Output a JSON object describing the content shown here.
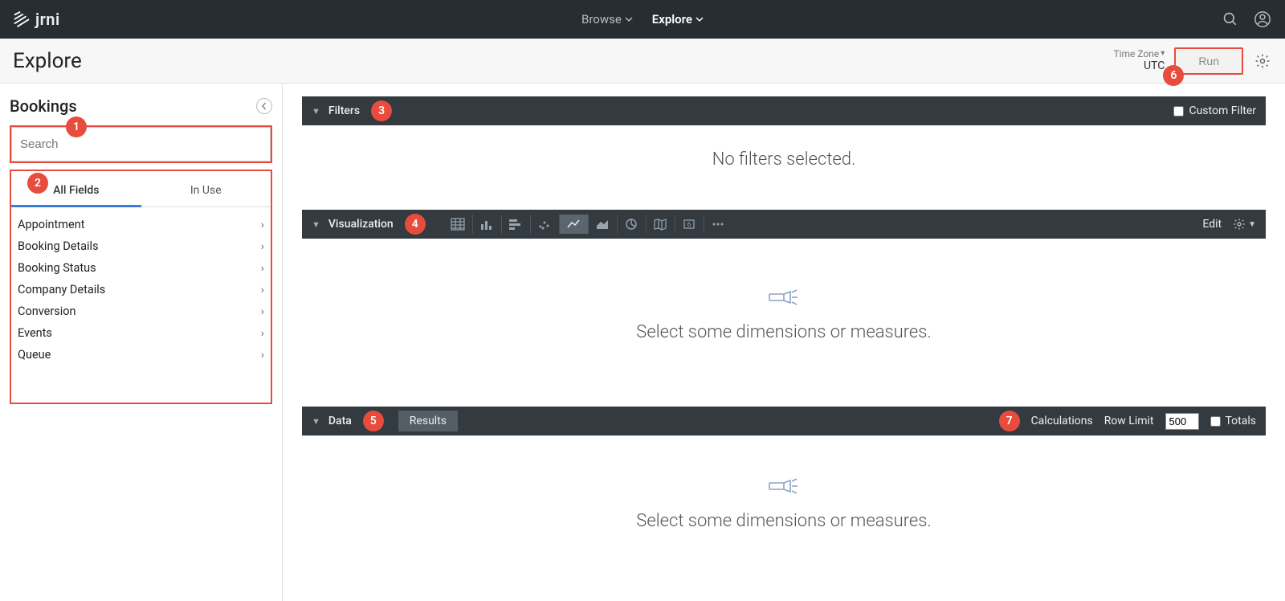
{
  "logo": {
    "text": "jrni"
  },
  "nav": {
    "browse": "Browse",
    "explore": "Explore"
  },
  "subheader": {
    "title": "Explore",
    "timezone_label": "Time Zone",
    "timezone_value": "UTC",
    "run": "Run"
  },
  "sidebar": {
    "title": "Bookings",
    "search_placeholder": "Search",
    "tabs": {
      "all": "All Fields",
      "in_use": "In Use"
    },
    "fields": [
      "Appointment",
      "Booking Details",
      "Booking Status",
      "Company Details",
      "Conversion",
      "Events",
      "Queue"
    ]
  },
  "filters": {
    "title": "Filters",
    "custom_label": "Custom Filter",
    "empty": "No filters selected."
  },
  "viz": {
    "title": "Visualization",
    "edit": "Edit",
    "empty": "Select some dimensions or measures."
  },
  "data": {
    "title": "Data",
    "results": "Results",
    "calculations": "Calculations",
    "row_limit_label": "Row Limit",
    "row_limit_value": "500",
    "totals": "Totals",
    "empty": "Select some dimensions or measures."
  },
  "annotations": {
    "1": "1",
    "2": "2",
    "3": "3",
    "4": "4",
    "5": "5",
    "6": "6",
    "7": "7"
  }
}
